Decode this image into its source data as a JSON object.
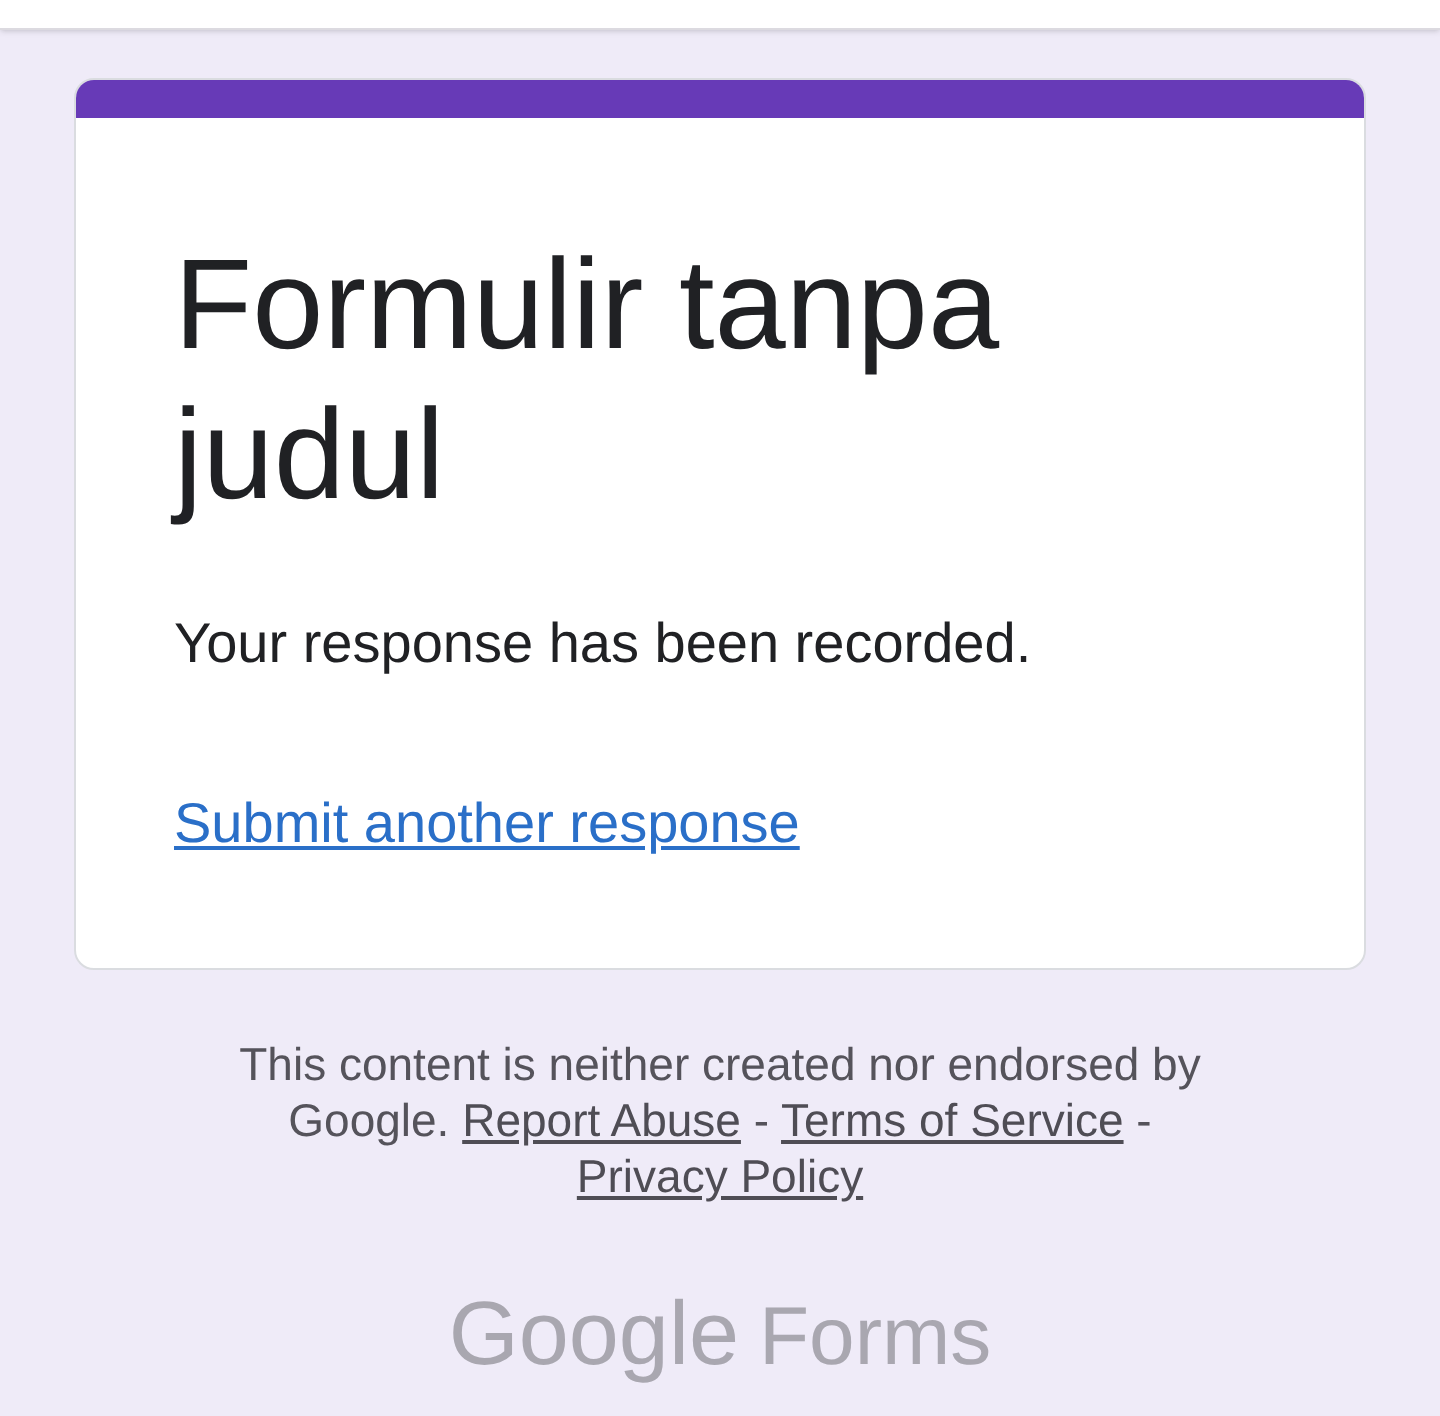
{
  "form": {
    "title": "Formulir tanpa judul",
    "confirmation": "Your response has been recorded.",
    "link": "Submit another response"
  },
  "footer": {
    "disclaimer": [
      {
        "kind": "text",
        "text": "This content is neither created nor endorsed by Google."
      },
      {
        "kind": "link",
        "text": "Report Abuse"
      },
      {
        "kind": "text",
        "text": "-"
      },
      {
        "kind": "link",
        "text": "Terms of Service"
      },
      {
        "kind": "text",
        "text": "-"
      },
      {
        "kind": "link",
        "text": "Privacy Policy"
      }
    ]
  },
  "logo": {
    "brand": "Google",
    "product": "Forms"
  }
}
